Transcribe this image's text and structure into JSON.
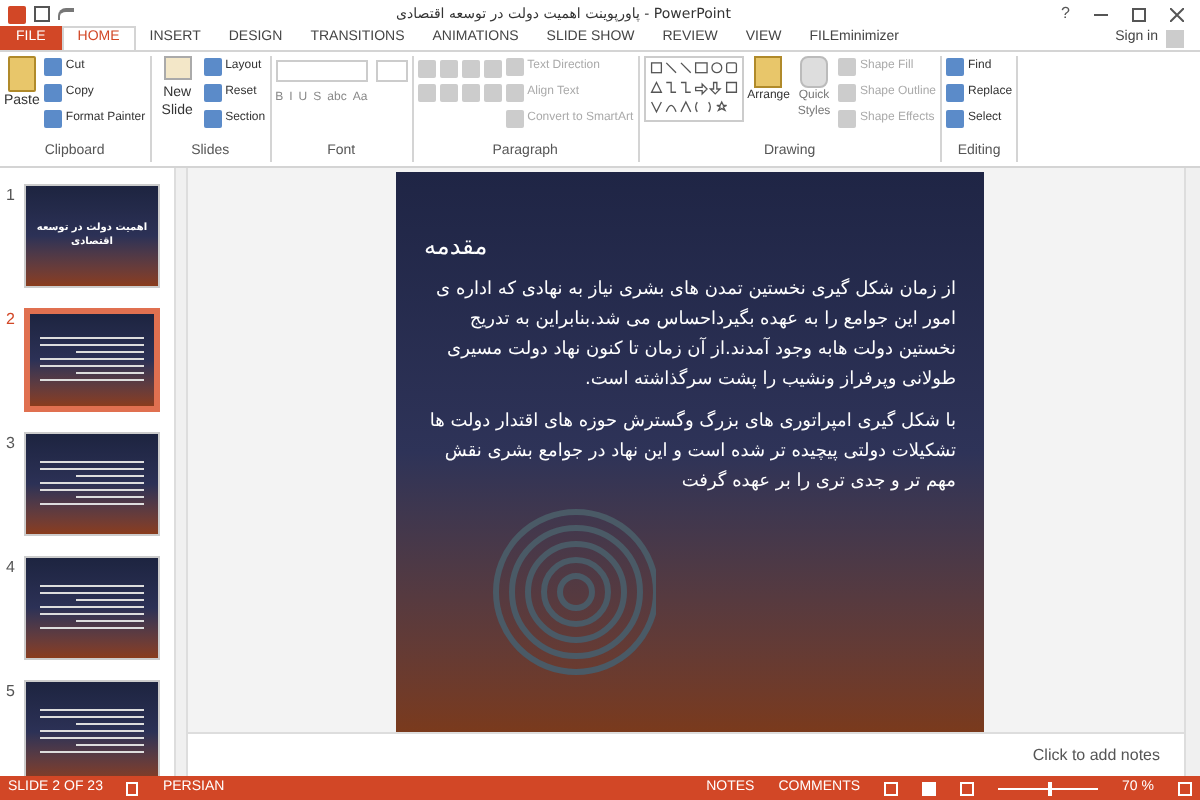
{
  "window": {
    "title": "پاورپوینت اهمیت دولت در توسعه اقتصادی - PowerPoint",
    "help": "?",
    "sign_in": "Sign in"
  },
  "tabs": [
    {
      "label": "FILE",
      "kind": "file",
      "selected": false
    },
    {
      "label": "HOME",
      "kind": "tab",
      "selected": true
    },
    {
      "label": "INSERT",
      "kind": "tab",
      "selected": false
    },
    {
      "label": "DESIGN",
      "kind": "tab",
      "selected": false
    },
    {
      "label": "TRANSITIONS",
      "kind": "tab",
      "selected": false
    },
    {
      "label": "ANIMATIONS",
      "kind": "tab",
      "selected": false
    },
    {
      "label": "SLIDE SHOW",
      "kind": "tab",
      "selected": false
    },
    {
      "label": "REVIEW",
      "kind": "tab",
      "selected": false
    },
    {
      "label": "VIEW",
      "kind": "tab",
      "selected": false
    },
    {
      "label": "FILEminimizer",
      "kind": "tab",
      "selected": false
    }
  ],
  "ribbon": {
    "clipboard": {
      "label": "Clipboard",
      "paste": "Paste",
      "items": [
        "Cut",
        "Copy",
        "Format Painter"
      ]
    },
    "slides": {
      "label": "Slides",
      "new_slide": "New Slide",
      "items": [
        "Layout",
        "Reset",
        "Section"
      ]
    },
    "font": {
      "label": "Font",
      "format_buttons": [
        "B",
        "I",
        "U",
        "S",
        "abc",
        "Aa"
      ]
    },
    "paragraph": {
      "label": "Paragraph",
      "items": [
        {
          "label": "Text Direction",
          "disabled": true
        },
        {
          "label": "Align Text",
          "disabled": true
        },
        {
          "label": "Convert to SmartArt",
          "disabled": true
        }
      ]
    },
    "drawing": {
      "label": "Drawing",
      "arrange": "Arrange",
      "quick_styles": "Quick Styles",
      "items": [
        {
          "label": "Shape Fill",
          "disabled": true
        },
        {
          "label": "Shape Outline",
          "disabled": true
        },
        {
          "label": "Shape Effects",
          "disabled": true
        }
      ]
    },
    "editing": {
      "label": "Editing",
      "items": [
        "Find",
        "Replace",
        "Select"
      ]
    }
  },
  "thumbnails": [
    {
      "number": "1",
      "title": "اهمیت دولت در توسعه اقتصادی",
      "selected": false
    },
    {
      "number": "2",
      "selected": true
    },
    {
      "number": "3",
      "selected": false
    },
    {
      "number": "4",
      "selected": false
    },
    {
      "number": "5",
      "selected": false
    }
  ],
  "slide": {
    "heading": "مقدمه",
    "paragraphs": [
      "از زمان شکل گیری نخستین تمدن های بشری نیاز به نهادی که اداره ی امور این جوامع را به عهده بگیرداحساس می شد.بنابراین به تدریج نخستین دولت هابه وجود آمدند.از آن زمان تا کنون نهاد دولت مسیری طولانی وپرفراز ونشیب را پشت سرگذاشته است.",
      "با شکل گیری امپراتوری های بزرگ وگسترش حوزه های اقتدار دولت ها تشکیلات دولتی پیچیده تر شده است و این نهاد در جوامع بشری نقش مهم تر و جدی تری را بر عهده گرفت"
    ]
  },
  "notes": {
    "placeholder": "Click to add notes"
  },
  "status_bar": {
    "slide": "SLIDE 2 OF 23",
    "language": "PERSIAN",
    "notes": "NOTES",
    "comments": "COMMENTS",
    "zoom": "70 %",
    "zoom_level": {
      "level": 0.5
    }
  }
}
